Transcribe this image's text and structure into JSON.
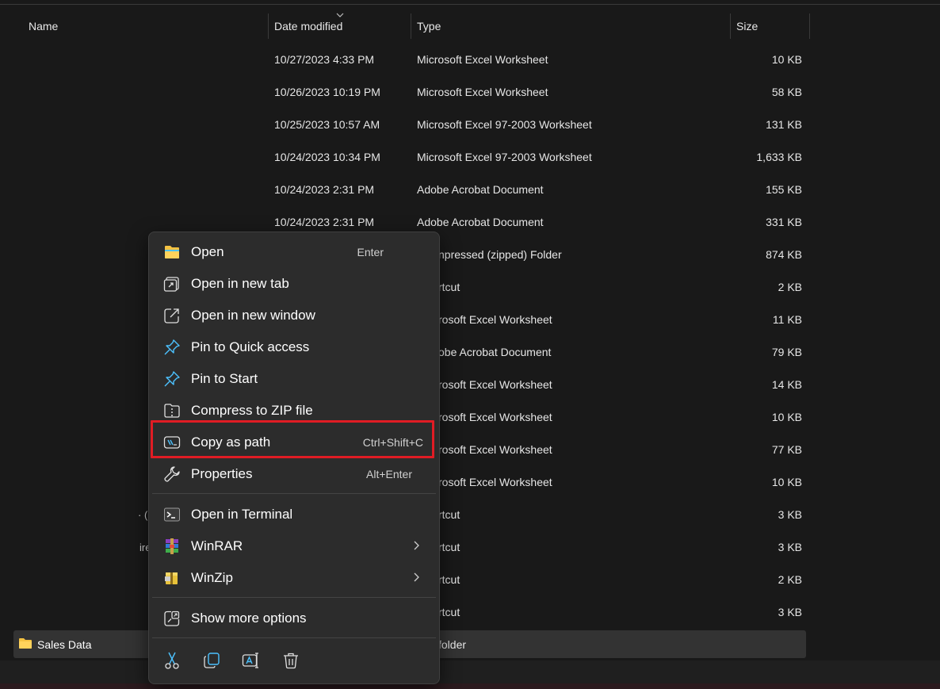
{
  "columns": {
    "name": "Name",
    "date_modified": "Date modified",
    "type": "Type",
    "size": "Size"
  },
  "rows": [
    {
      "date": "10/27/2023 4:33 PM",
      "type": "Microsoft Excel Worksheet",
      "size": "10 KB"
    },
    {
      "date": "10/26/2023 10:19 PM",
      "type": "Microsoft Excel Worksheet",
      "size": "58 KB"
    },
    {
      "date": "10/25/2023 10:57 AM",
      "type": "Microsoft Excel 97-2003 Worksheet",
      "size": "131 KB"
    },
    {
      "date": "10/24/2023 10:34 PM",
      "type": "Microsoft Excel 97-2003 Worksheet",
      "size": "1,633 KB"
    },
    {
      "date": "10/24/2023 2:31 PM",
      "type": "Adobe Acrobat Document",
      "size": "155 KB"
    },
    {
      "date": "10/24/2023 2:31 PM",
      "type": "Adobe Acrobat Document",
      "size": "331 KB"
    },
    {
      "type": "npressed (zipped) Folder",
      "size": "874 KB"
    },
    {
      "type": "rtcut",
      "size": "2 KB"
    },
    {
      "type": "rosoft Excel Worksheet",
      "size": "11 KB"
    },
    {
      "type": "obe Acrobat Document",
      "size": "79 KB"
    },
    {
      "type": "rosoft Excel Worksheet",
      "size": "14 KB"
    },
    {
      "type": "rosoft Excel Worksheet",
      "size": "10 KB"
    },
    {
      "type": "rosoft Excel Worksheet",
      "size": "77 KB"
    },
    {
      "type": "rosoft Excel Worksheet",
      "size": "10 KB"
    },
    {
      "type": "rtcut",
      "size": "3 KB"
    },
    {
      "type": "rtcut",
      "size": "3 KB"
    },
    {
      "type": "rtcut",
      "size": "2 KB"
    },
    {
      "type": "rtcut",
      "size": "3 KB"
    }
  ],
  "fragments": {
    "row14_name": "· (",
    "row15_name": "ire"
  },
  "selected": {
    "name": "Sales Data",
    "type": "folder"
  },
  "context_menu": {
    "items": [
      {
        "label": "Open",
        "shortcut": "Enter",
        "icon": "folder-open-icon"
      },
      {
        "label": "Open in new tab",
        "icon": "new-tab-icon"
      },
      {
        "label": "Open in new window",
        "icon": "new-window-icon"
      },
      {
        "label": "Pin to Quick access",
        "icon": "pin-icon"
      },
      {
        "label": "Pin to Start",
        "icon": "pin-icon"
      },
      {
        "label": "Compress to ZIP file",
        "icon": "zip-icon"
      },
      {
        "label": "Copy as path",
        "shortcut": "Ctrl+Shift+C",
        "icon": "copy-path-icon"
      },
      {
        "label": "Properties",
        "shortcut": "Alt+Enter",
        "icon": "wrench-icon"
      },
      {
        "label": "Open in Terminal",
        "icon": "terminal-icon"
      },
      {
        "label": "WinRAR",
        "icon": "winrar-icon"
      },
      {
        "label": "WinZip",
        "icon": "winzip-icon"
      },
      {
        "label": "Show more options",
        "icon": "more-options-icon"
      }
    ],
    "actions": [
      "cut-icon",
      "copy-icon",
      "rename-icon",
      "delete-icon"
    ]
  },
  "colors": {
    "background": "#191919",
    "menu": "#2c2c2c",
    "highlight": "#e01c24",
    "accent_blue": "#4cc2ff",
    "folder_yellow": "#f5c242"
  }
}
